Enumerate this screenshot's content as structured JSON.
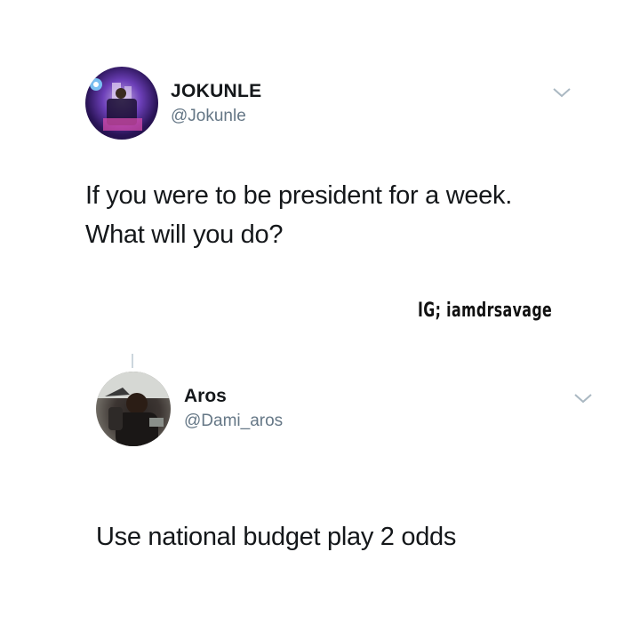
{
  "tweet": {
    "display_name": "JOKUNLE",
    "handle": "@Jokunle",
    "text_lines": [
      "If you were to be president for a week.",
      "What will you do?"
    ],
    "avatar_icon": "profile-photo",
    "menu_icon": "chevron-down-icon"
  },
  "watermark": {
    "text": "IG; iamdrsavage"
  },
  "reply": {
    "display_name": "Aros",
    "handle": "@Dami_aros",
    "text": "Use national budget play 2 odds",
    "avatar_icon": "profile-photo",
    "menu_icon": "chevron-down-icon"
  },
  "colors": {
    "text": "#14171a",
    "secondary": "#657786",
    "chevron": "#aab8c2",
    "background": "#ffffff"
  }
}
